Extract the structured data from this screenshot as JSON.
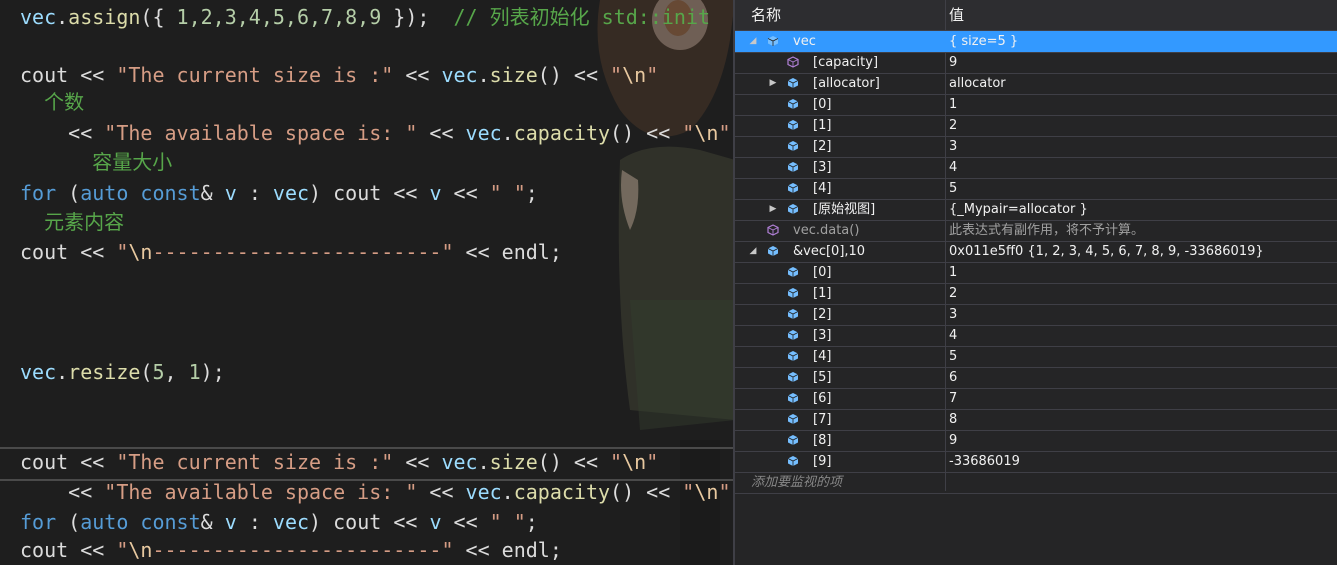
{
  "editor": {
    "lines": [
      {
        "kind": "code",
        "segments": [
          {
            "c": "var",
            "t": "vec"
          },
          {
            "c": "pl",
            "t": "."
          },
          {
            "c": "fn",
            "t": "assign"
          },
          {
            "c": "pl",
            "t": "({ "
          },
          {
            "c": "num",
            "t": "1,2,3,4,5,6,7,8,9"
          },
          {
            "c": "pl",
            "t": " });  "
          },
          {
            "c": "com",
            "t": "// 列表初始化 std::init"
          }
        ]
      },
      {
        "kind": "code",
        "segments": [
          {
            "c": "pl",
            "t": "cout << "
          },
          {
            "c": "str",
            "t": "\"The current size is :\""
          },
          {
            "c": "pl",
            "t": " << "
          },
          {
            "c": "var",
            "t": "vec"
          },
          {
            "c": "pl",
            "t": "."
          },
          {
            "c": "fn",
            "t": "size"
          },
          {
            "c": "pl",
            "t": "() << "
          },
          {
            "c": "str",
            "t": "\""
          },
          {
            "c": "esc",
            "t": "\\n"
          },
          {
            "c": "str",
            "t": "\""
          }
        ]
      },
      {
        "kind": "comment",
        "segments": [
          {
            "c": "com",
            "t": "  个数"
          }
        ]
      },
      {
        "kind": "code",
        "segments": [
          {
            "c": "pl",
            "t": "    << "
          },
          {
            "c": "str",
            "t": "\"The available space is: \""
          },
          {
            "c": "pl",
            "t": " << "
          },
          {
            "c": "var",
            "t": "vec"
          },
          {
            "c": "pl",
            "t": "."
          },
          {
            "c": "fn",
            "t": "capacity"
          },
          {
            "c": "pl",
            "t": "() << "
          },
          {
            "c": "str",
            "t": "\""
          },
          {
            "c": "esc",
            "t": "\\n"
          },
          {
            "c": "str",
            "t": "\""
          }
        ]
      },
      {
        "kind": "comment",
        "segments": [
          {
            "c": "com",
            "t": "      容量大小"
          }
        ]
      },
      {
        "kind": "code",
        "segments": [
          {
            "c": "kw",
            "t": "for"
          },
          {
            "c": "pl",
            "t": " ("
          },
          {
            "c": "kw",
            "t": "auto const"
          },
          {
            "c": "pl",
            "t": "& "
          },
          {
            "c": "var",
            "t": "v"
          },
          {
            "c": "pl",
            "t": " : "
          },
          {
            "c": "var",
            "t": "vec"
          },
          {
            "c": "pl",
            "t": ") cout << "
          },
          {
            "c": "var",
            "t": "v"
          },
          {
            "c": "pl",
            "t": " << "
          },
          {
            "c": "str",
            "t": "\" \""
          },
          {
            "c": "pl",
            "t": ";"
          }
        ]
      },
      {
        "kind": "comment",
        "segments": [
          {
            "c": "com",
            "t": "  元素内容"
          }
        ]
      },
      {
        "kind": "code",
        "segments": [
          {
            "c": "pl",
            "t": "cout << "
          },
          {
            "c": "str",
            "t": "\""
          },
          {
            "c": "esc",
            "t": "\\n"
          },
          {
            "c": "str",
            "t": "------------------------\""
          },
          {
            "c": "pl",
            "t": " << endl;"
          }
        ]
      },
      {
        "kind": "code",
        "segments": [
          {
            "c": "var",
            "t": "vec"
          },
          {
            "c": "pl",
            "t": "."
          },
          {
            "c": "fn",
            "t": "resize"
          },
          {
            "c": "pl",
            "t": "("
          },
          {
            "c": "num",
            "t": "5"
          },
          {
            "c": "pl",
            "t": ", "
          },
          {
            "c": "num",
            "t": "1"
          },
          {
            "c": "pl",
            "t": ");"
          }
        ]
      },
      {
        "kind": "code",
        "segments": [
          {
            "c": "pl",
            "t": "cout << "
          },
          {
            "c": "str",
            "t": "\"The current size is :\""
          },
          {
            "c": "pl",
            "t": " << "
          },
          {
            "c": "var",
            "t": "vec"
          },
          {
            "c": "pl",
            "t": "."
          },
          {
            "c": "fn",
            "t": "size"
          },
          {
            "c": "pl",
            "t": "() << "
          },
          {
            "c": "str",
            "t": "\""
          },
          {
            "c": "esc",
            "t": "\\n"
          },
          {
            "c": "str",
            "t": "\""
          }
        ]
      },
      {
        "kind": "code",
        "segments": [
          {
            "c": "pl",
            "t": "    << "
          },
          {
            "c": "str",
            "t": "\"The available space is: \""
          },
          {
            "c": "pl",
            "t": " << "
          },
          {
            "c": "var",
            "t": "vec"
          },
          {
            "c": "pl",
            "t": "."
          },
          {
            "c": "fn",
            "t": "capacity"
          },
          {
            "c": "pl",
            "t": "() << "
          },
          {
            "c": "str",
            "t": "\""
          },
          {
            "c": "esc",
            "t": "\\n"
          },
          {
            "c": "str",
            "t": "\""
          }
        ]
      },
      {
        "kind": "code",
        "segments": [
          {
            "c": "kw",
            "t": "for"
          },
          {
            "c": "pl",
            "t": " ("
          },
          {
            "c": "kw",
            "t": "auto const"
          },
          {
            "c": "pl",
            "t": "& "
          },
          {
            "c": "var",
            "t": "v"
          },
          {
            "c": "pl",
            "t": " : "
          },
          {
            "c": "var",
            "t": "vec"
          },
          {
            "c": "pl",
            "t": ") cout << "
          },
          {
            "c": "var",
            "t": "v"
          },
          {
            "c": "pl",
            "t": " << "
          },
          {
            "c": "str",
            "t": "\" \""
          },
          {
            "c": "pl",
            "t": ";"
          }
        ]
      },
      {
        "kind": "code",
        "segments": [
          {
            "c": "pl",
            "t": "cout << "
          },
          {
            "c": "str",
            "t": "\""
          },
          {
            "c": "esc",
            "t": "\\n"
          },
          {
            "c": "str",
            "t": "------------------------\""
          },
          {
            "c": "pl",
            "t": " << endl;"
          }
        ]
      }
    ],
    "highlighted_line": 9
  },
  "watch": {
    "header": {
      "name": "名称",
      "value": "值"
    },
    "rows": [
      {
        "depth": 0,
        "expander": "expanded",
        "icon": "object",
        "name": "vec",
        "value": "{ size=5 }",
        "selected": true
      },
      {
        "depth": 1,
        "expander": "none",
        "icon": "property",
        "name": "[capacity]",
        "value": "9"
      },
      {
        "depth": 1,
        "expander": "collapsed",
        "icon": "object",
        "name": "[allocator]",
        "value": "allocator"
      },
      {
        "depth": 1,
        "expander": "none",
        "icon": "object",
        "name": "[0]",
        "value": "1"
      },
      {
        "depth": 1,
        "expander": "none",
        "icon": "object",
        "name": "[1]",
        "value": "2"
      },
      {
        "depth": 1,
        "expander": "none",
        "icon": "object",
        "name": "[2]",
        "value": "3"
      },
      {
        "depth": 1,
        "expander": "none",
        "icon": "object",
        "name": "[3]",
        "value": "4"
      },
      {
        "depth": 1,
        "expander": "none",
        "icon": "object",
        "name": "[4]",
        "value": "5"
      },
      {
        "depth": 1,
        "expander": "collapsed",
        "icon": "object",
        "name": "[原始视图]",
        "value": "{_Mypair=allocator }"
      },
      {
        "depth": 0,
        "expander": "none",
        "icon": "property",
        "name": "vec.data()",
        "value": "此表达式有副作用，将不予计算。",
        "dim": true
      },
      {
        "depth": 0,
        "expander": "expanded",
        "icon": "object",
        "name": "&vec[0],10",
        "value": "0x011e5ff0 {1, 2, 3, 4, 5, 6, 7, 8, 9, -33686019}"
      },
      {
        "depth": 1,
        "expander": "none",
        "icon": "object",
        "name": "[0]",
        "value": "1"
      },
      {
        "depth": 1,
        "expander": "none",
        "icon": "object",
        "name": "[1]",
        "value": "2"
      },
      {
        "depth": 1,
        "expander": "none",
        "icon": "object",
        "name": "[2]",
        "value": "3"
      },
      {
        "depth": 1,
        "expander": "none",
        "icon": "object",
        "name": "[3]",
        "value": "4"
      },
      {
        "depth": 1,
        "expander": "none",
        "icon": "object",
        "name": "[4]",
        "value": "5"
      },
      {
        "depth": 1,
        "expander": "none",
        "icon": "object",
        "name": "[5]",
        "value": "6"
      },
      {
        "depth": 1,
        "expander": "none",
        "icon": "object",
        "name": "[6]",
        "value": "7"
      },
      {
        "depth": 1,
        "expander": "none",
        "icon": "object",
        "name": "[7]",
        "value": "8"
      },
      {
        "depth": 1,
        "expander": "none",
        "icon": "object",
        "name": "[8]",
        "value": "9"
      },
      {
        "depth": 1,
        "expander": "none",
        "icon": "object",
        "name": "[9]",
        "value": "-33686019"
      },
      {
        "depth": 0,
        "expander": "none",
        "icon": "none",
        "name": "添加要监视的项",
        "value": "",
        "add": true
      }
    ]
  },
  "colors": {
    "editor_bg": "#1e1e1e",
    "watch_bg": "#252526",
    "selection": "#3399ff",
    "comment": "#57a64a",
    "string": "#d69d85",
    "keyword": "#569cd6",
    "variable": "#9cdcfe",
    "function": "#dcdcaa",
    "object_icon": "#75beff",
    "property_icon": "#b180d7"
  }
}
